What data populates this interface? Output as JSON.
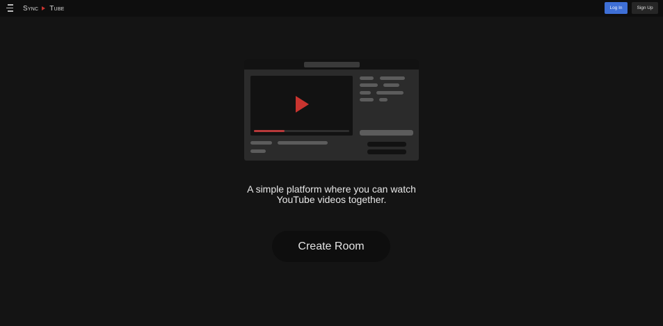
{
  "header": {
    "menu_icon": "hamburger-menu-icon",
    "logo": {
      "word1": "Sync",
      "word2": "Tube",
      "icon": "play-triangle-icon",
      "icon_color": "#c9342f"
    },
    "login_label": "Log In",
    "signup_label": "Sign Up",
    "login_color": "#3e6fd6"
  },
  "hero": {
    "illustration": "video-player-illustration",
    "play_icon": "play-icon",
    "progress_fraction": 0.32,
    "tagline_line1": "A simple platform where you can watch",
    "tagline_line2": "YouTube videos together.",
    "cta_label": "Create Room"
  },
  "colors": {
    "background": "#141414",
    "accent_red": "#c9342f"
  }
}
